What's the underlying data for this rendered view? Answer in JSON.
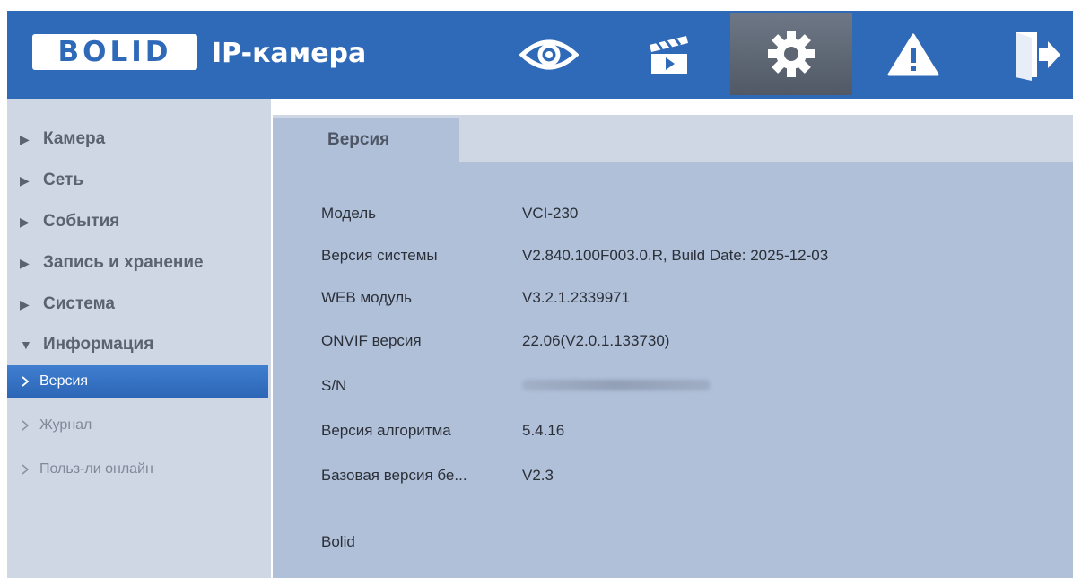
{
  "header": {
    "logo_text": "BOLID",
    "app_title": "IP-камера",
    "nav_icons": [
      "eye-icon",
      "clapperboard-icon",
      "gear-icon",
      "warning-icon",
      "logout-icon"
    ],
    "active_nav": "gear-icon"
  },
  "sidebar": {
    "items": [
      {
        "label": "Камера",
        "expanded": false
      },
      {
        "label": "Сеть",
        "expanded": false
      },
      {
        "label": "События",
        "expanded": false
      },
      {
        "label": "Запись и хранение",
        "expanded": false
      },
      {
        "label": "Система",
        "expanded": false
      },
      {
        "label": "Информация",
        "expanded": true
      }
    ],
    "subitems": [
      {
        "label": "Версия",
        "active": true
      },
      {
        "label": "Журнал",
        "active": false
      },
      {
        "label": "Польз-ли онлайн",
        "active": false
      }
    ]
  },
  "main": {
    "tab": "Версия",
    "rows": [
      {
        "label": "Модель",
        "value": "VCI-230"
      },
      {
        "label": "Версия системы",
        "value": "V2.840.100F003.0.R, Build Date: 2025-12-03"
      },
      {
        "label": "WEB модуль",
        "value": "V3.2.1.2339971"
      },
      {
        "label": "ONVIF версия",
        "value": "22.06(V2.0.1.133730)"
      },
      {
        "label": "S/N",
        "value": ""
      },
      {
        "label": "Версия алгоритма",
        "value": "5.4.16"
      },
      {
        "label": "Базовая версия бе...",
        "value": "V2.3"
      }
    ],
    "footer": "Bolid"
  },
  "colors": {
    "header_bg": "#2f6ab8",
    "sidebar_bg": "#ced7e3",
    "content_bg": "#b0c0d9",
    "active_item": "#3573c4"
  }
}
